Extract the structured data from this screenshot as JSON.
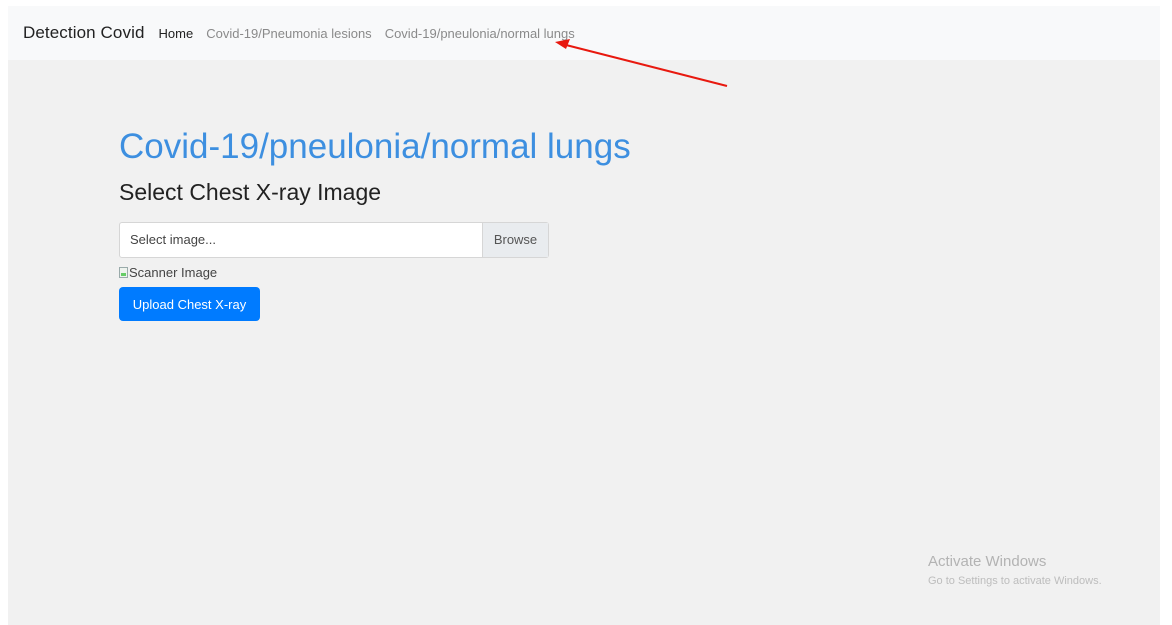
{
  "navbar": {
    "brand": "Detection Covid",
    "links": [
      {
        "label": "Home"
      },
      {
        "label": "Covid-19/Pneumonia lesions"
      },
      {
        "label": "Covid-19/pneulonia/normal lungs"
      }
    ]
  },
  "main": {
    "title": "Covid-19/pneulonia/normal lungs",
    "subtitle": "Select Chest X-ray Image",
    "file_input": {
      "placeholder": "Select image...",
      "browse_label": "Browse"
    },
    "image_alt": "Scanner Image",
    "upload_label": "Upload Chest X-ray"
  },
  "watermark": {
    "title": "Activate Windows",
    "subtitle": "Go to Settings to activate Windows."
  },
  "colors": {
    "title": "#3d8fe0",
    "primary_button": "#007bff",
    "annotation_arrow": "#e8190f"
  }
}
